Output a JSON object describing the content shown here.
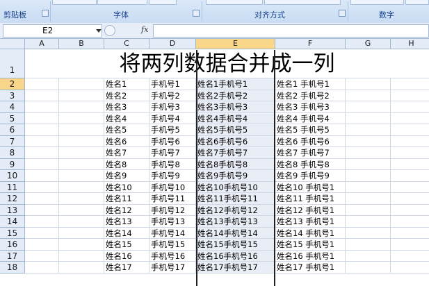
{
  "ribbon": {
    "groups": [
      {
        "label": "剪贴板"
      },
      {
        "label": "字体"
      },
      {
        "label": "对齐方式"
      },
      {
        "label": "数字"
      }
    ]
  },
  "formula_bar": {
    "name_box": "E2",
    "fx_label": "fx",
    "formula": ""
  },
  "sheet": {
    "columns": [
      "A",
      "B",
      "C",
      "D",
      "E",
      "F",
      "G",
      "H"
    ],
    "selected_column": "E",
    "selected_row": "2",
    "title": "将两列数据合并成一列",
    "rows": [
      {
        "n": "1"
      },
      {
        "n": "2",
        "c": "姓名1",
        "d": "手机号1",
        "e": "姓名1手机号1",
        "f": "姓名1  手机号1"
      },
      {
        "n": "3",
        "c": "姓名2",
        "d": "手机号2",
        "e": "姓名2手机号2",
        "f": "姓名2  手机号2"
      },
      {
        "n": "4",
        "c": "姓名3",
        "d": "手机号3",
        "e": "姓名3手机号3",
        "f": "姓名3  手机号3"
      },
      {
        "n": "5",
        "c": "姓名4",
        "d": "手机号4",
        "e": "姓名4手机号4",
        "f": "姓名4  手机号4"
      },
      {
        "n": "6",
        "c": "姓名5",
        "d": "手机号5",
        "e": "姓名5手机号5",
        "f": "姓名5  手机号5"
      },
      {
        "n": "7",
        "c": "姓名6",
        "d": "手机号6",
        "e": "姓名6手机号6",
        "f": "姓名6  手机号6"
      },
      {
        "n": "8",
        "c": "姓名7",
        "d": "手机号7",
        "e": "姓名7手机号7",
        "f": "姓名7  手机号7"
      },
      {
        "n": "9",
        "c": "姓名8",
        "d": "手机号8",
        "e": "姓名8手机号8",
        "f": "姓名8  手机号8"
      },
      {
        "n": "10",
        "c": "姓名9",
        "d": "手机号9",
        "e": "姓名9手机号9",
        "f": "姓名9  手机号9"
      },
      {
        "n": "11",
        "c": "姓名10",
        "d": "手机号10",
        "e": "姓名10手机号10",
        "f": "姓名10  手机号1"
      },
      {
        "n": "12",
        "c": "姓名11",
        "d": "手机号11",
        "e": "姓名11手机号11",
        "f": "姓名11  手机号1"
      },
      {
        "n": "13",
        "c": "姓名12",
        "d": "手机号12",
        "e": "姓名12手机号12",
        "f": "姓名12  手机号1"
      },
      {
        "n": "14",
        "c": "姓名13",
        "d": "手机号13",
        "e": "姓名13手机号13",
        "f": "姓名13  手机号1"
      },
      {
        "n": "15",
        "c": "姓名14",
        "d": "手机号14",
        "e": "姓名14手机号14",
        "f": "姓名14  手机号1"
      },
      {
        "n": "16",
        "c": "姓名15",
        "d": "手机号15",
        "e": "姓名15手机号15",
        "f": "姓名15  手机号1"
      },
      {
        "n": "17",
        "c": "姓名16",
        "d": "手机号16",
        "e": "姓名16手机号16",
        "f": "姓名16  手机号1"
      },
      {
        "n": "18",
        "c": "姓名17",
        "d": "手机号17",
        "e": "姓名17手机号17",
        "f": "姓名17  手机号1"
      }
    ]
  }
}
